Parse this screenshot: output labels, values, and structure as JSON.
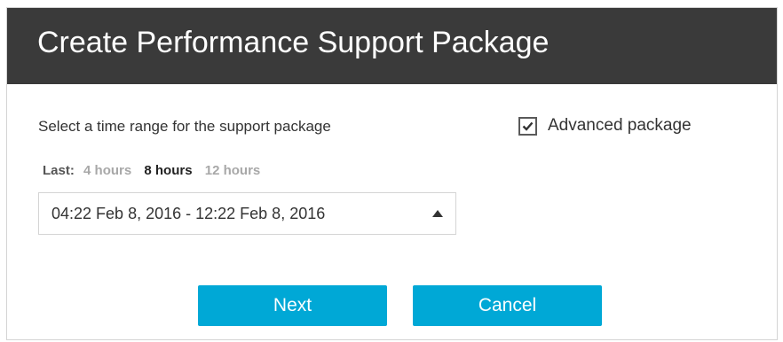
{
  "dialog": {
    "title": "Create Performance Support Package"
  },
  "instruction": "Select a time range for the support package",
  "advanced": {
    "label": "Advanced package",
    "checked": true,
    "icon": "check-icon"
  },
  "range": {
    "label": "Last:",
    "options": [
      {
        "label": "4 hours",
        "selected": false
      },
      {
        "label": "8 hours",
        "selected": true
      },
      {
        "label": "12 hours",
        "selected": false
      }
    ]
  },
  "select": {
    "value": "04:22 Feb 8, 2016 - 12:22 Feb 8, 2016",
    "icon": "caret-up-icon"
  },
  "buttons": {
    "next": "Next",
    "cancel": "Cancel"
  },
  "colors": {
    "title_bar": "#3a3a3a",
    "button": "#00a8d6",
    "inactive_text": "#a8a8a8"
  }
}
